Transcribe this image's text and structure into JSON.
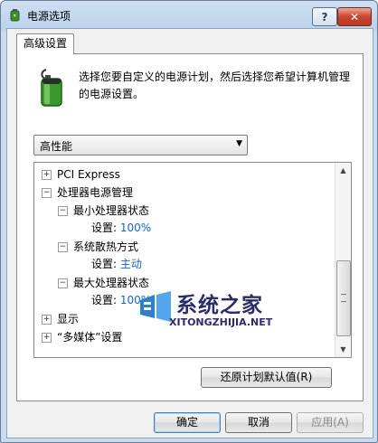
{
  "window": {
    "title": "电源选项",
    "help_label": "?",
    "close_label": "✕"
  },
  "tab": {
    "label": "高级设置"
  },
  "description": "选择您要自定义的电源计划，然后选择您希望计算机管理的电源设置。",
  "plan_select": {
    "value": "高性能"
  },
  "tree": {
    "items": [
      {
        "expander": "+",
        "label": "PCI Express"
      },
      {
        "expander": "−",
        "label": "处理器电源管理"
      },
      {
        "expander": "−",
        "label": "最小处理器状态"
      },
      {
        "setting_label": "设置:",
        "value": "100%"
      },
      {
        "expander": "−",
        "label": "系统散热方式"
      },
      {
        "setting_label": "设置:",
        "value": "主动"
      },
      {
        "expander": "−",
        "label": "最大处理器状态"
      },
      {
        "setting_label": "设置:",
        "value": "100%"
      },
      {
        "expander": "+",
        "label": "显示"
      },
      {
        "expander": "+",
        "label": "“多媒体”设置"
      }
    ]
  },
  "buttons": {
    "restore": "还原计划默认值(R)",
    "ok": "确定",
    "cancel": "取消",
    "apply": "应用(A)"
  },
  "watermark": {
    "text": "系统之家",
    "sub": "XITONGZHIJIA.NET"
  },
  "colors": {
    "setting_value": "#1464c8",
    "title_gradient_top": "#cfe0f2"
  }
}
